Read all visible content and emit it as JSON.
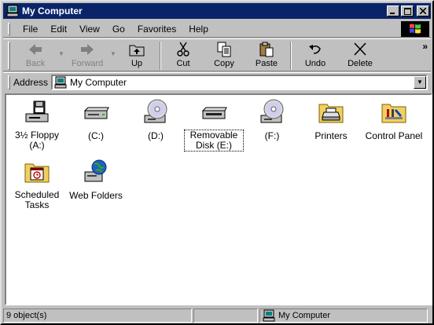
{
  "window": {
    "title": "My Computer"
  },
  "menubar": {
    "items": [
      {
        "label": "File"
      },
      {
        "label": "Edit"
      },
      {
        "label": "View"
      },
      {
        "label": "Go"
      },
      {
        "label": "Favorites"
      },
      {
        "label": "Help"
      }
    ]
  },
  "toolbar": {
    "back_label": "Back",
    "forward_label": "Forward",
    "up_label": "Up",
    "cut_label": "Cut",
    "copy_label": "Copy",
    "paste_label": "Paste",
    "undo_label": "Undo",
    "delete_label": "Delete",
    "overflow": "»"
  },
  "address": {
    "label": "Address",
    "value": "My Computer"
  },
  "items": [
    {
      "label": "3½ Floppy (A:)",
      "icon": "floppy-drive-icon"
    },
    {
      "label": "(C:)",
      "icon": "hard-drive-icon"
    },
    {
      "label": "(D:)",
      "icon": "cd-drive-icon"
    },
    {
      "label": "Removable Disk (E:)",
      "icon": "removable-disk-icon"
    },
    {
      "label": "(F:)",
      "icon": "cd-drive-icon"
    },
    {
      "label": "Printers",
      "icon": "printers-folder-icon"
    },
    {
      "label": "Control Panel",
      "icon": "control-panel-icon"
    },
    {
      "label": "Scheduled Tasks",
      "icon": "scheduled-tasks-icon"
    },
    {
      "label": "Web Folders",
      "icon": "web-folders-icon"
    }
  ],
  "status": {
    "count": "9 object(s)",
    "location": "My Computer"
  },
  "colors": {
    "titlebar": "#0a246a",
    "face": "#c0c0c0",
    "content_bg": "#ffffff"
  }
}
